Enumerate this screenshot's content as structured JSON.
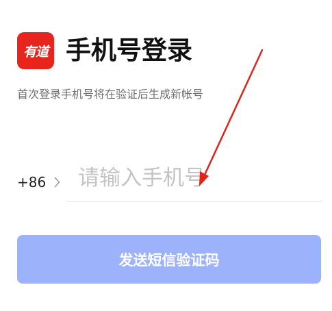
{
  "brand": {
    "logo_text": "有道",
    "logo_color": "#e8251c"
  },
  "header": {
    "title": "手机号登录",
    "subtitle": "首次登录手机号将在验证后生成新帐号"
  },
  "phone": {
    "country_code": "+86",
    "placeholder": "请输入手机号",
    "value": ""
  },
  "actions": {
    "send_code_label": "发送短信验证码",
    "send_code_color": "#9cb3fb"
  },
  "annotation": {
    "color": "#e0231b"
  }
}
